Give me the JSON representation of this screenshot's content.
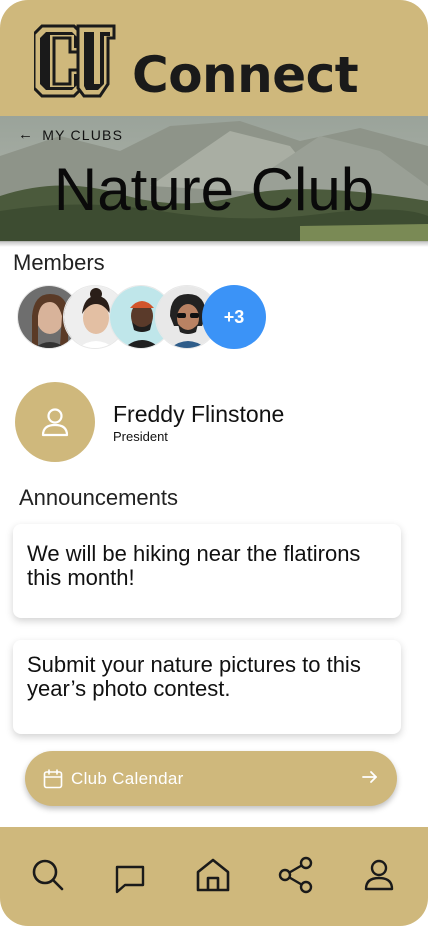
{
  "app": {
    "title": "Connect"
  },
  "header": {
    "back_label": "MY CLUBS",
    "club_name": "Nature Club"
  },
  "members": {
    "title": "Members",
    "more_count": "+3"
  },
  "president": {
    "name": "Freddy Flinstone",
    "role": "President"
  },
  "announcements": {
    "title": "Announcements",
    "items": [
      {
        "text": "We will be hiking near the flatirons this month!"
      },
      {
        "text": "Submit your nature pictures to this year’s photo contest."
      }
    ]
  },
  "calendar_button": {
    "label": "Club Calendar"
  },
  "bottom_nav": {
    "items": [
      "search-icon",
      "chat-icon",
      "home-icon",
      "share-icon",
      "user-icon"
    ]
  },
  "colors": {
    "brand_gold": "#CFB87C",
    "accent_blue": "#3B93F7",
    "brand_black": "#1a1a1a"
  }
}
